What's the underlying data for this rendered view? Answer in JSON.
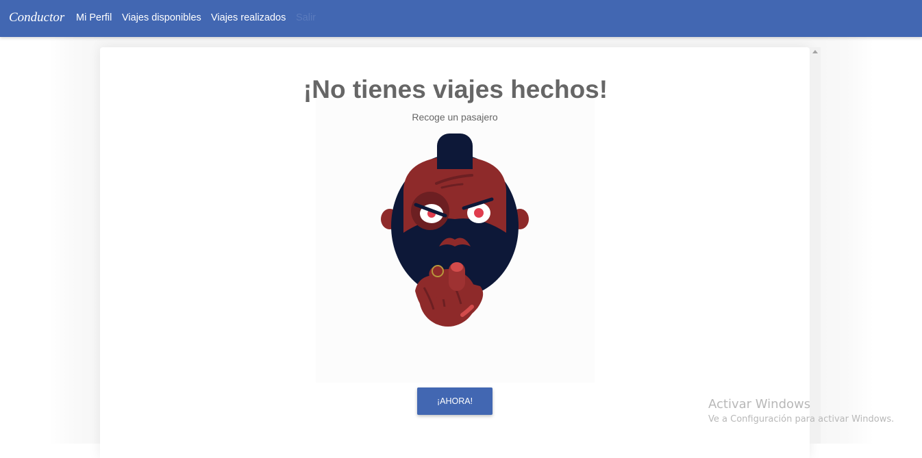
{
  "navbar": {
    "brand": "Conductor",
    "links": [
      {
        "label": "Mi Perfil",
        "disabled": false
      },
      {
        "label": "Viajes disponibles",
        "disabled": false
      },
      {
        "label": "Viajes realizados",
        "disabled": false
      },
      {
        "label": "Salir",
        "disabled": true
      }
    ],
    "color": "#4267b2"
  },
  "empty_state": {
    "title": "¡No tienes viajes hechos!",
    "subtitle": "Recoge un pasajero",
    "illustration": "angry-bearded-man-pointing-icon",
    "button_label": "¡AHORA!"
  },
  "watermark": {
    "title": "Activar Windows",
    "subtitle": "Ve a Configuración para activar Windows."
  },
  "colors": {
    "accent": "#4267b2",
    "text": "#666666",
    "skin": "#8e2a2a",
    "hair": "#0d1838",
    "eye_red": "#e03d4e"
  }
}
